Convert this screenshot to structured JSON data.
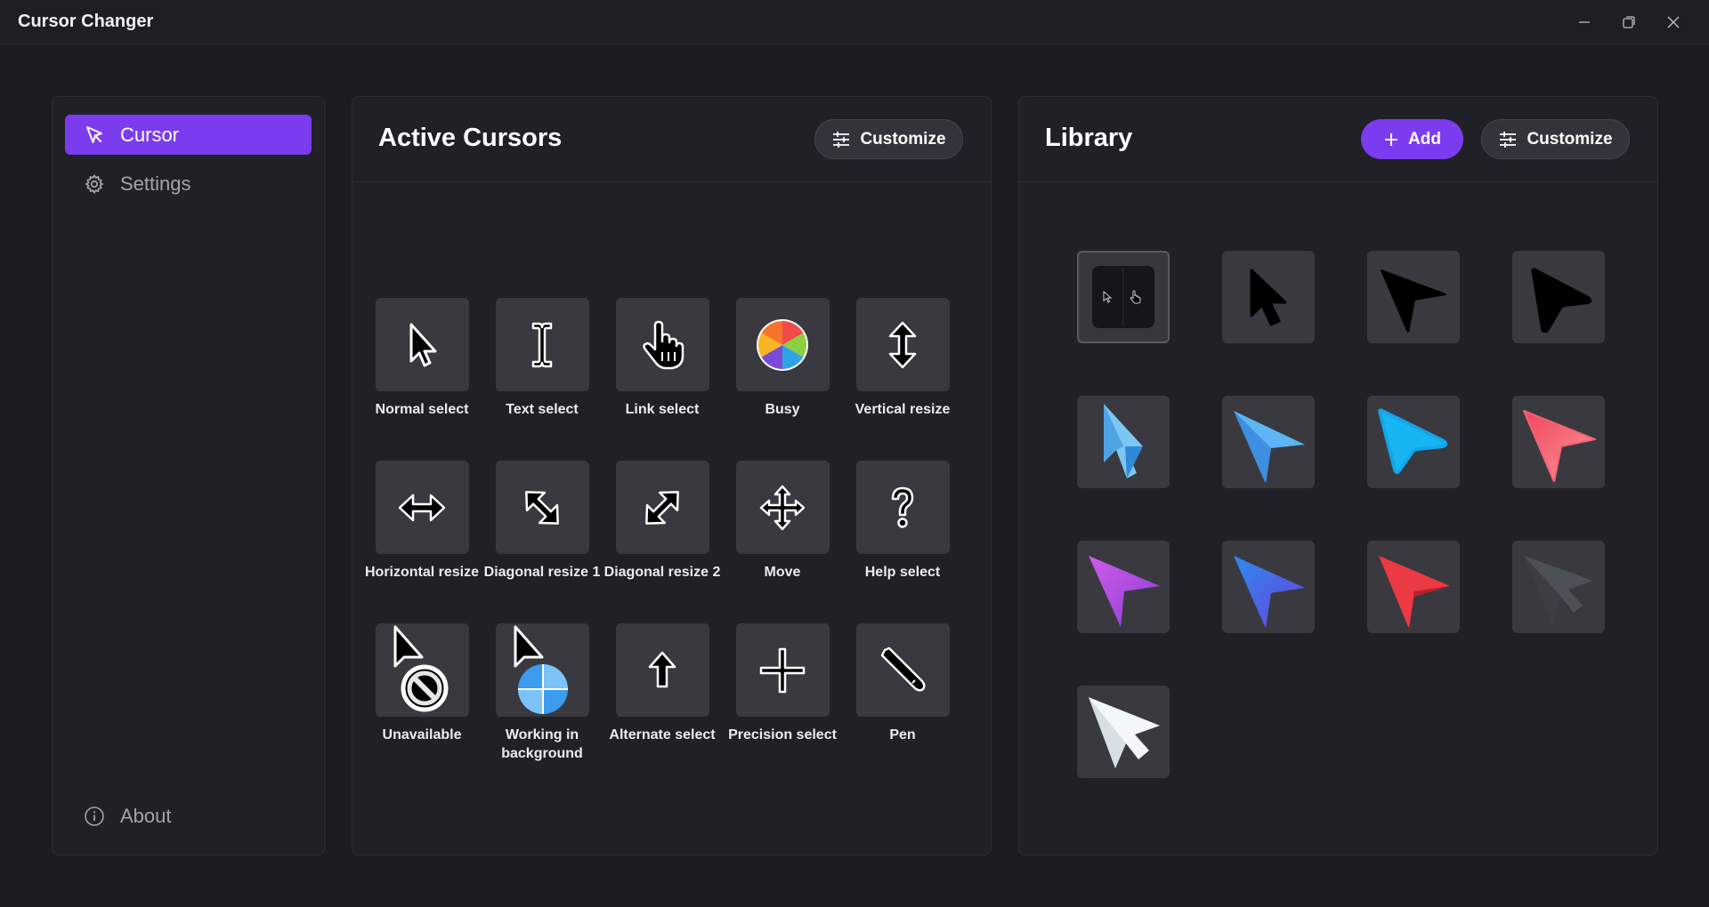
{
  "window": {
    "title": "Cursor Changer",
    "controls": [
      "minimize-icon",
      "restore-icon",
      "close-icon"
    ]
  },
  "sidebar": {
    "items": [
      {
        "label": "Cursor",
        "icon": "pointer-icon",
        "active": true
      },
      {
        "label": "Settings",
        "icon": "gear-icon",
        "active": false
      }
    ],
    "footer": {
      "label": "About",
      "icon": "info-icon"
    }
  },
  "active_cursors": {
    "title": "Active Cursors",
    "customize_label": "Customize",
    "items": [
      {
        "label": "Normal select",
        "icon": "arrow-cursor-icon"
      },
      {
        "label": "Text select",
        "icon": "ibeam-cursor-icon"
      },
      {
        "label": "Link select",
        "icon": "hand-cursor-icon"
      },
      {
        "label": "Busy",
        "icon": "spinner-wheel-icon"
      },
      {
        "label": "Vertical resize",
        "icon": "vertical-resize-icon"
      },
      {
        "label": "Horizontal resize",
        "icon": "horizontal-resize-icon"
      },
      {
        "label": "Diagonal resize 1",
        "icon": "diagonal-resize-1-icon"
      },
      {
        "label": "Diagonal resize 2",
        "icon": "diagonal-resize-2-icon"
      },
      {
        "label": "Move",
        "icon": "move-icon"
      },
      {
        "label": "Help select",
        "icon": "help-icon"
      },
      {
        "label": "Unavailable",
        "icon": "unavailable-icon"
      },
      {
        "label": "Working in background",
        "icon": "working-background-icon"
      },
      {
        "label": "Alternate select",
        "icon": "up-arrow-icon"
      },
      {
        "label": "Precision select",
        "icon": "crosshair-icon"
      },
      {
        "label": "Pen",
        "icon": "pen-icon"
      }
    ]
  },
  "library": {
    "title": "Library",
    "add_label": "Add",
    "customize_label": "Customize",
    "items": [
      {
        "icon": "default-cursor-pack-icon",
        "selected": true
      },
      {
        "icon": "black-arrow-cursor-icon",
        "color": "#000000"
      },
      {
        "icon": "black-pointer-cursor-icon",
        "color": "#000000"
      },
      {
        "icon": "black-rounded-pointer-icon",
        "color": "#000000"
      },
      {
        "icon": "light-blue-arrow-cursor-icon",
        "color": "#5ab4ee"
      },
      {
        "icon": "blue-pointer-cursor-icon",
        "color": "#4ea8f3"
      },
      {
        "icon": "cyan-rounded-pointer-icon",
        "color": "#14aeee"
      },
      {
        "icon": "pink-pointer-cursor-icon",
        "color": "#f5637c"
      },
      {
        "icon": "purple-pointer-cursor-icon",
        "color": "#b552e6"
      },
      {
        "icon": "blue-violet-pointer-cursor-icon",
        "color": "#3f72ee"
      },
      {
        "icon": "red-pointer-cursor-icon",
        "color": "#e8343d"
      },
      {
        "icon": "dark-gray-arrow-cursor-icon",
        "color": "#4a4c52"
      },
      {
        "icon": "white-arrow-cursor-icon",
        "color": "#f2f5f7"
      }
    ]
  },
  "colors": {
    "accent": "#7b3cf0",
    "background": "#1c1b22",
    "panel": "#212027",
    "tile": "#3a393f"
  }
}
